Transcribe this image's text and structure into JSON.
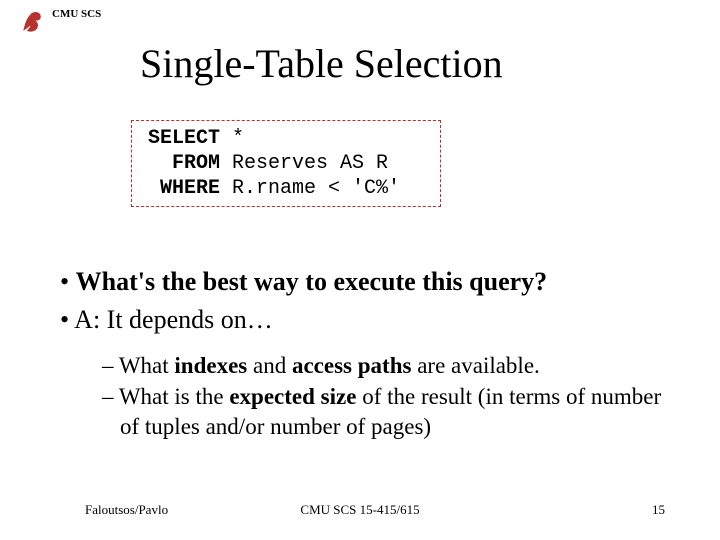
{
  "header": {
    "org": "CMU SCS"
  },
  "title": "Single-Table Selection",
  "sql": {
    "kw1": "SELECT",
    "arg1": " *",
    "kw2": "FROM",
    "arg2": " Reserves AS R",
    "kw3": "WHERE",
    "arg3": " R.rname < 'C%'"
  },
  "bullets": {
    "b1_pre": "• ",
    "b1_bold": "What's the best way to execute this query?",
    "b2": "• A:  It depends on…",
    "s1_pre": "– What ",
    "s1_b1": "indexes",
    "s1_mid": " and ",
    "s1_b2": "access paths",
    "s1_post": " are available.",
    "s2_pre": "– What is the ",
    "s2_b1": "expected size",
    "s2_post": " of the result (in terms of number of tuples and/or number of pages)"
  },
  "footer": {
    "left": "Faloutsos/Pavlo",
    "center": "CMU SCS 15-415/615",
    "right": "15"
  }
}
